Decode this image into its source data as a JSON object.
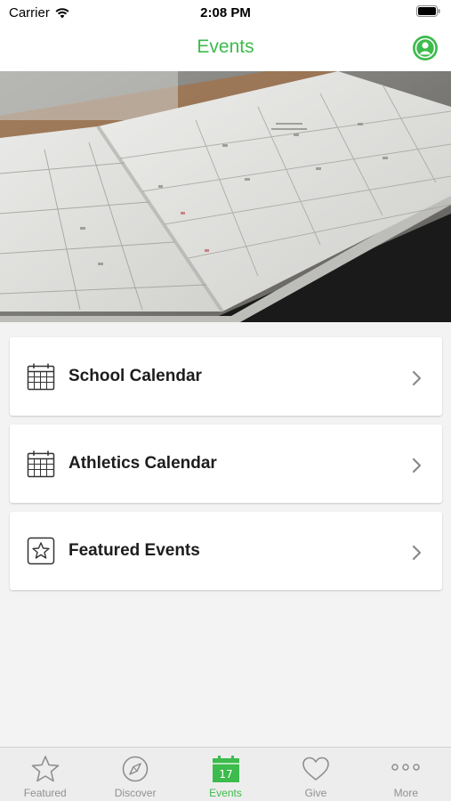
{
  "status_bar": {
    "carrier": "Carrier",
    "time": "2:08 PM"
  },
  "nav": {
    "title": "Events"
  },
  "menu": [
    {
      "label": "School Calendar",
      "icon": "calendar-icon"
    },
    {
      "label": "Athletics Calendar",
      "icon": "calendar-icon"
    },
    {
      "label": "Featured Events",
      "icon": "star-box-icon"
    }
  ],
  "tabs": [
    {
      "label": "Featured",
      "icon": "star-icon",
      "active": false
    },
    {
      "label": "Discover",
      "icon": "compass-icon",
      "active": false
    },
    {
      "label": "Events",
      "icon": "calendar-17-icon",
      "active": true,
      "icon_text": "17"
    },
    {
      "label": "Give",
      "icon": "heart-icon",
      "active": false
    },
    {
      "label": "More",
      "icon": "more-dots-icon",
      "active": false
    }
  ],
  "colors": {
    "accent": "#3dbb4c",
    "tab_inactive": "#909090",
    "background": "#f3f3f3"
  }
}
